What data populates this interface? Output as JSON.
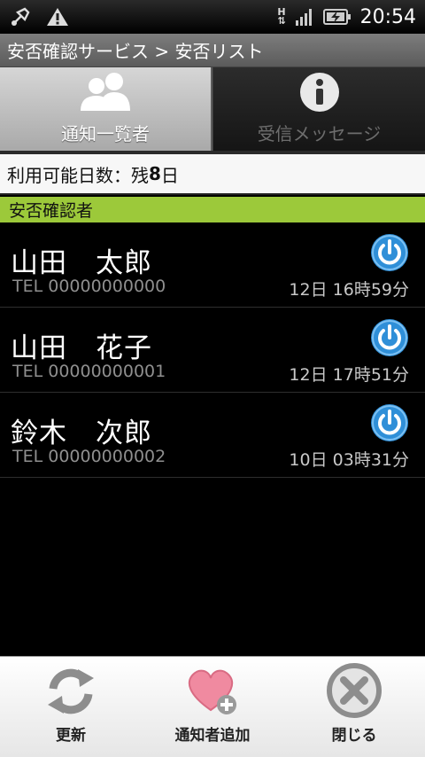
{
  "status_bar": {
    "time": "20:54",
    "network": "H"
  },
  "title_bar": {
    "title": "安否確認サービス > 安否リスト"
  },
  "tabs": [
    {
      "label": "通知一覧者",
      "icon": "people-icon",
      "active": true
    },
    {
      "label": "受信メッセージ",
      "icon": "info-icon",
      "active": false
    }
  ],
  "usage": {
    "prefix": "利用可能日数：残",
    "days": "8",
    "suffix": "日"
  },
  "section": {
    "title": "安否確認者"
  },
  "contacts": [
    {
      "name": "山田　太郎",
      "tel": "TEL 00000000000",
      "time": "12日 16時59分"
    },
    {
      "name": "山田　花子",
      "tel": "TEL 00000000001",
      "time": "12日 17時51分"
    },
    {
      "name": "鈴木　次郎",
      "tel": "TEL 00000000002",
      "time": "10日 03時31分"
    }
  ],
  "menu": [
    {
      "label": "更新",
      "icon": "refresh-icon"
    },
    {
      "label": "通知者追加",
      "icon": "heart-add-icon"
    },
    {
      "label": "閉じる",
      "icon": "close-circle-icon"
    }
  ],
  "colors": {
    "section_green": "#9cc93a",
    "power_blue": "#2f8fd8"
  }
}
